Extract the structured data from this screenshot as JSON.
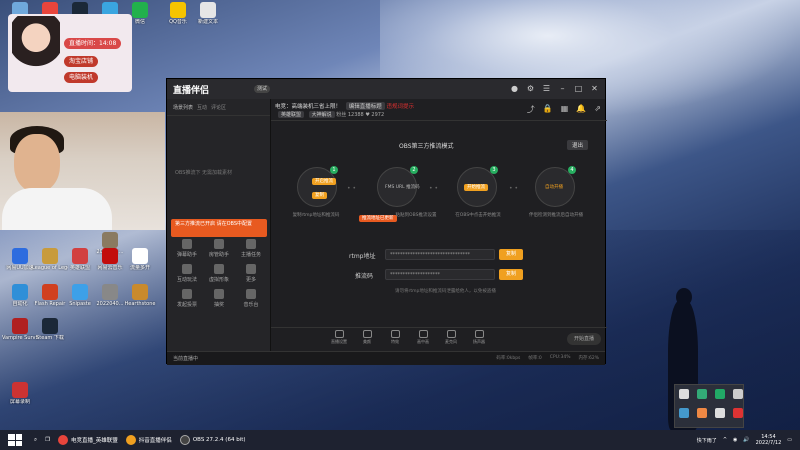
{
  "desktop": {
    "icons": [
      {
        "label": "回收站",
        "color": "#6fa8dc"
      },
      {
        "label": "Google",
        "color": "#e8453c"
      },
      {
        "label": "Steam",
        "color": "#1b2838"
      },
      {
        "label": "QQ",
        "color": "#3aa5e0"
      },
      {
        "label": "微信",
        "color": "#22b14c"
      },
      {
        "label": "QQ音乐",
        "color": "#f5c400"
      },
      {
        "label": "新建文本",
        "color": "#e6e6e6"
      },
      {
        "label": "2020061...",
        "color": "#8a7a60"
      },
      {
        "label": "网易UU加速",
        "color": "#2d6cdf"
      },
      {
        "label": "League of Legends",
        "color": "#c89b3c"
      },
      {
        "label": "英雄联盟",
        "color": "#d24040"
      },
      {
        "label": "网易云音乐",
        "color": "#c20c0c"
      },
      {
        "label": "流量多开",
        "color": "#ffffff"
      },
      {
        "label": "自动化",
        "color": "#2f8fd8"
      },
      {
        "label": "Flash Repair",
        "color": "#d04020"
      },
      {
        "label": "Snipaste",
        "color": "#3da0e8"
      },
      {
        "label": "2022040...",
        "color": "#888888"
      },
      {
        "label": "Hearthstone",
        "color": "#c98a2c"
      },
      {
        "label": "Vampire Survivors",
        "color": "#b02020"
      },
      {
        "label": "Steam 下载",
        "color": "#1b2838"
      },
      {
        "label": "屏幕录制",
        "color": "#c33"
      }
    ]
  },
  "overlay": {
    "timer_label": "直播时间：",
    "timer_value": "14:08",
    "tag1": "淘宝店铺",
    "tag2": "电脑装机"
  },
  "app": {
    "brand": "直播伴侣",
    "version_badge": "测试",
    "left_tabs": [
      "场景列表",
      "互动",
      "评论区"
    ],
    "left_empty_text": "OBS推流下 无需加载素材",
    "notice_text": "第三方推流已开启\n请在OBS中配置",
    "tools": [
      {
        "label": "弹幕助手"
      },
      {
        "label": "房管助手"
      },
      {
        "label": "主播任务"
      },
      {
        "label": "互动玩法"
      },
      {
        "label": "虚拟形象"
      },
      {
        "label": "更多"
      },
      {
        "label": "发起投票"
      },
      {
        "label": "抽奖"
      },
      {
        "label": "音乐台"
      }
    ],
    "room": {
      "title": "电竞：高端装机三省上限！",
      "title_tag": "编辑直播标题",
      "title_warn": "违规词提示",
      "category": "英雄联盟",
      "category_sub": "大神解说",
      "fans_label": "粉丝",
      "fans_value": "12388",
      "likes_value": "2972"
    },
    "mode_title": "OBS第三方推流模式",
    "exit_button": "退出",
    "steps": [
      {
        "num": "1",
        "button": "开启推流",
        "desc": "复制rtmp地址和推流码",
        "color": "#f0a020"
      },
      {
        "num": "2",
        "button": "FMS URL 推流码",
        "desc": "粘贴到OBS推流设置",
        "color": "#2a2a2d"
      },
      {
        "num": "3",
        "button": "开始推流",
        "desc": "在OBS中点击开始推流",
        "color": "#f0a020"
      },
      {
        "num": "4",
        "button": "自动开播",
        "desc": "伴侣检测到推流后自动开播",
        "color": "#2a2a2d"
      }
    ],
    "step2_hint": "推流地址已更新",
    "rtmp_label": "rtmp地址",
    "rtmp_value": "********************************",
    "key_label": "推流码",
    "key_value": "********************",
    "copy_label": "复制",
    "hint_text": "请勿将rtmp地址和推流码泄露给他人，以免被盗播",
    "bottom_tools": [
      "直播设置",
      "美颜",
      "特效",
      "画中画",
      "麦克风",
      "扬声器"
    ],
    "start_live": "开始直播",
    "status_left": "当前直播中",
    "status_right": [
      "码率:0kbps",
      "帧率:0",
      "CPU:34%",
      "内存:62%"
    ]
  },
  "taskbar": {
    "items": [
      {
        "label": "电竞直播_英雄联盟",
        "color": "#e8453c"
      },
      {
        "label": "抖音直播伴侣",
        "color": "#222"
      },
      {
        "label": "OBS 27.2.4 (64 bit)",
        "color": "#444"
      }
    ],
    "weather": "快下雨了",
    "time": "14:54",
    "date": "2022/7/12"
  }
}
